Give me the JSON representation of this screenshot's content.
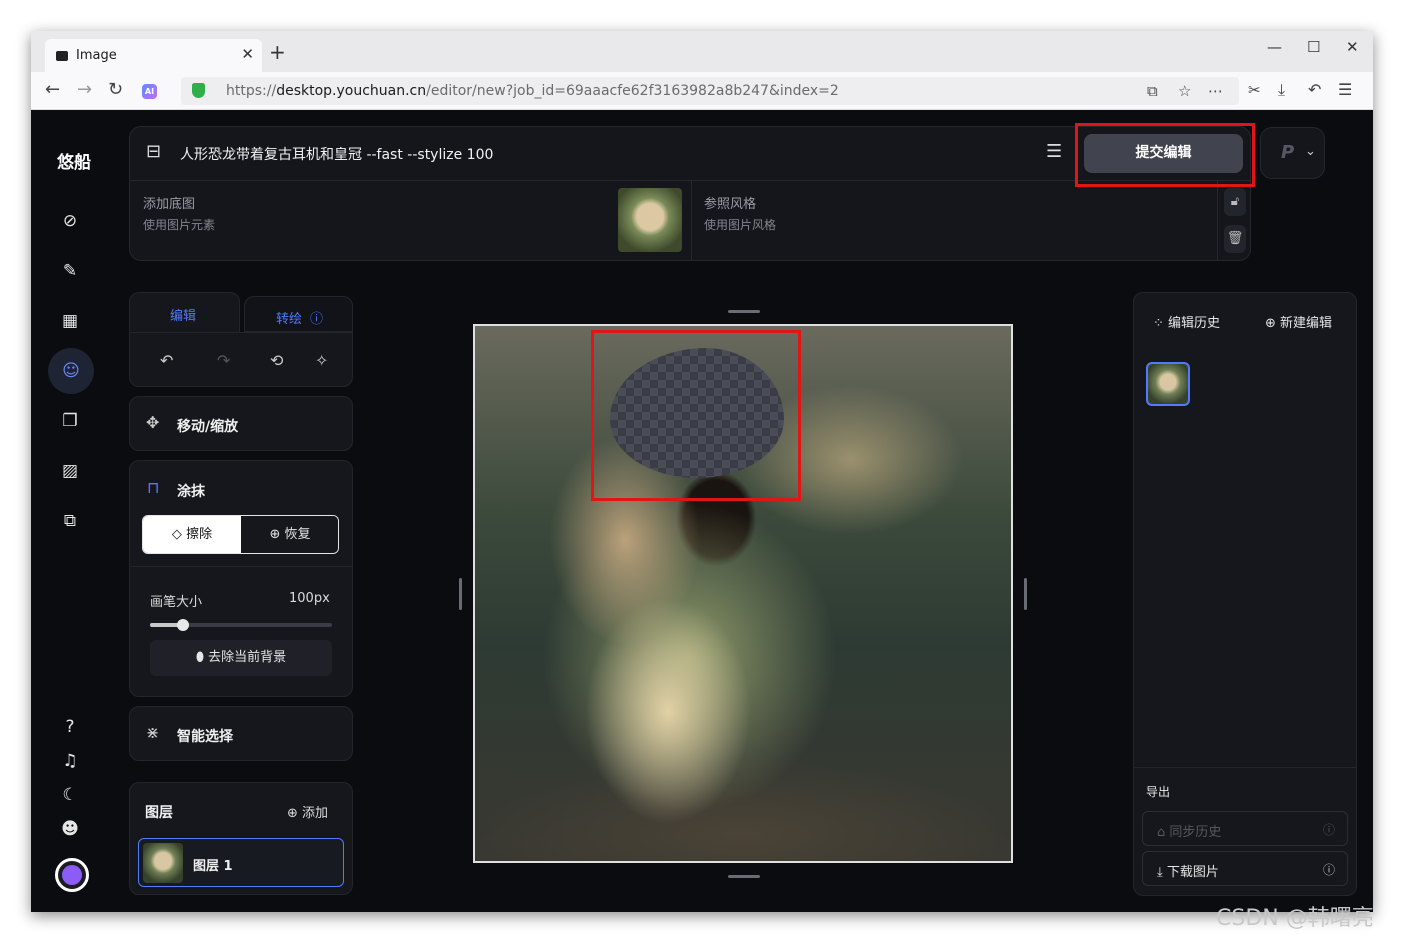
{
  "browser": {
    "tab_title": "Image",
    "new_tab": "+",
    "url_prefix": "https://",
    "url_host": "desktop.youchuan.cn",
    "url_path": "/editor/new?job_id=69aaacfe62f3163982a8b247&index=2",
    "ai_badge": "AI"
  },
  "app": {
    "logo": "悠船",
    "prompt_text": "人形恐龙带着复古耳机和皇冠 --fast --stylize 100",
    "submit_label": "提交编辑",
    "model_label": "P",
    "base_image_label": "添加底图",
    "base_image_sub": "使用图片元素",
    "style_ref_label": "参照风格",
    "style_ref_sub": "使用图片风格"
  },
  "left_panel": {
    "tab_edit": "编辑",
    "tab_paint": "转绘",
    "move_zoom": "移动/缩放",
    "brush_title": "涂抹",
    "erase_label": "擦除",
    "restore_label": "恢复",
    "brush_size_label": "画笔大小",
    "brush_size_value": "100px",
    "brush_size_fraction": 0.18,
    "remove_bg_label": "去除当前背景",
    "smart_select": "智能选择",
    "layers_title": "图层",
    "add_layer": "添加",
    "layer_name": "图层 1"
  },
  "right_panel": {
    "history_label": "编辑历史",
    "new_edit_label": "新建编辑",
    "export_label": "导出",
    "sync_history": "同步历史",
    "download_image": "下载图片"
  },
  "watermark": "CSDN @韩曙亮",
  "colors": {
    "accent": "#4d7cff",
    "highlight": "#e01515",
    "app_bg": "#0b0c0f",
    "panel_bg": "#16171c"
  }
}
